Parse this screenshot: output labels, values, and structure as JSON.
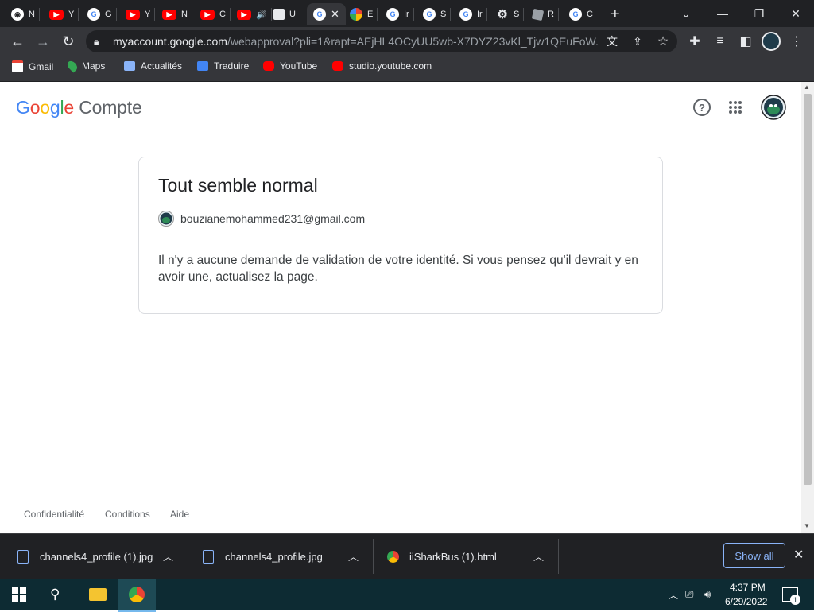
{
  "browser": {
    "tabs": [
      {
        "title": "N",
        "icon": "chrome-icon"
      },
      {
        "title": "Y",
        "icon": "youtube-icon"
      },
      {
        "title": "G",
        "icon": "google-icon"
      },
      {
        "title": "Y",
        "icon": "youtube-icon"
      },
      {
        "title": "N",
        "icon": "youtube-icon"
      },
      {
        "title": "C",
        "icon": "youtube-icon"
      },
      {
        "title": "",
        "icon": "youtube-audio-icon"
      },
      {
        "title": "U",
        "icon": "page-icon"
      },
      {
        "title": "",
        "icon": "google-icon",
        "active": true
      },
      {
        "title": "E",
        "icon": "pinwheel-icon"
      },
      {
        "title": "Ir",
        "icon": "google-icon"
      },
      {
        "title": "S",
        "icon": "google-icon"
      },
      {
        "title": "Ir",
        "icon": "google-icon"
      },
      {
        "title": "S",
        "icon": "gear-icon"
      },
      {
        "title": "R",
        "icon": "roblox-icon"
      },
      {
        "title": "C",
        "icon": "google-icon"
      }
    ],
    "url_domain": "myaccount.google.com",
    "url_rest": "/webapproval?pli=1&rapt=AEjHL4OCyUU5wb-X7DYZ23vKl_Tjw1QEuFoW...",
    "bookmarks": [
      {
        "label": "Gmail",
        "icon": "gmail-icon"
      },
      {
        "label": "Maps",
        "icon": "maps-icon"
      },
      {
        "label": "Actualités",
        "icon": "news-icon"
      },
      {
        "label": "Traduire",
        "icon": "translate-icon"
      },
      {
        "label": "YouTube",
        "icon": "youtube-icon"
      },
      {
        "label": "studio.youtube.com",
        "icon": "youtube-icon"
      }
    ]
  },
  "page": {
    "logo_google": "Google",
    "logo_compte": "Compte",
    "card_title": "Tout semble normal",
    "account_email": "bouzianemohammed231@gmail.com",
    "message": "Il n'y a aucune demande de validation de votre identité. Si vous pensez qu'il devrait y en avoir une, actualisez la page.",
    "footer": [
      "Confidentialité",
      "Conditions",
      "Aide"
    ]
  },
  "downloads": {
    "items": [
      "channels4_profile (1).jpg",
      "channels4_profile.jpg",
      "iiSharkBus (1).html"
    ],
    "show_all": "Show all"
  },
  "taskbar": {
    "time": "4:37 PM",
    "date": "6/29/2022",
    "notification_count": "1"
  },
  "colors": {
    "google_blue": "#4285F4",
    "google_red": "#EA4335",
    "google_yellow": "#FBBC05",
    "google_green": "#34A853"
  }
}
